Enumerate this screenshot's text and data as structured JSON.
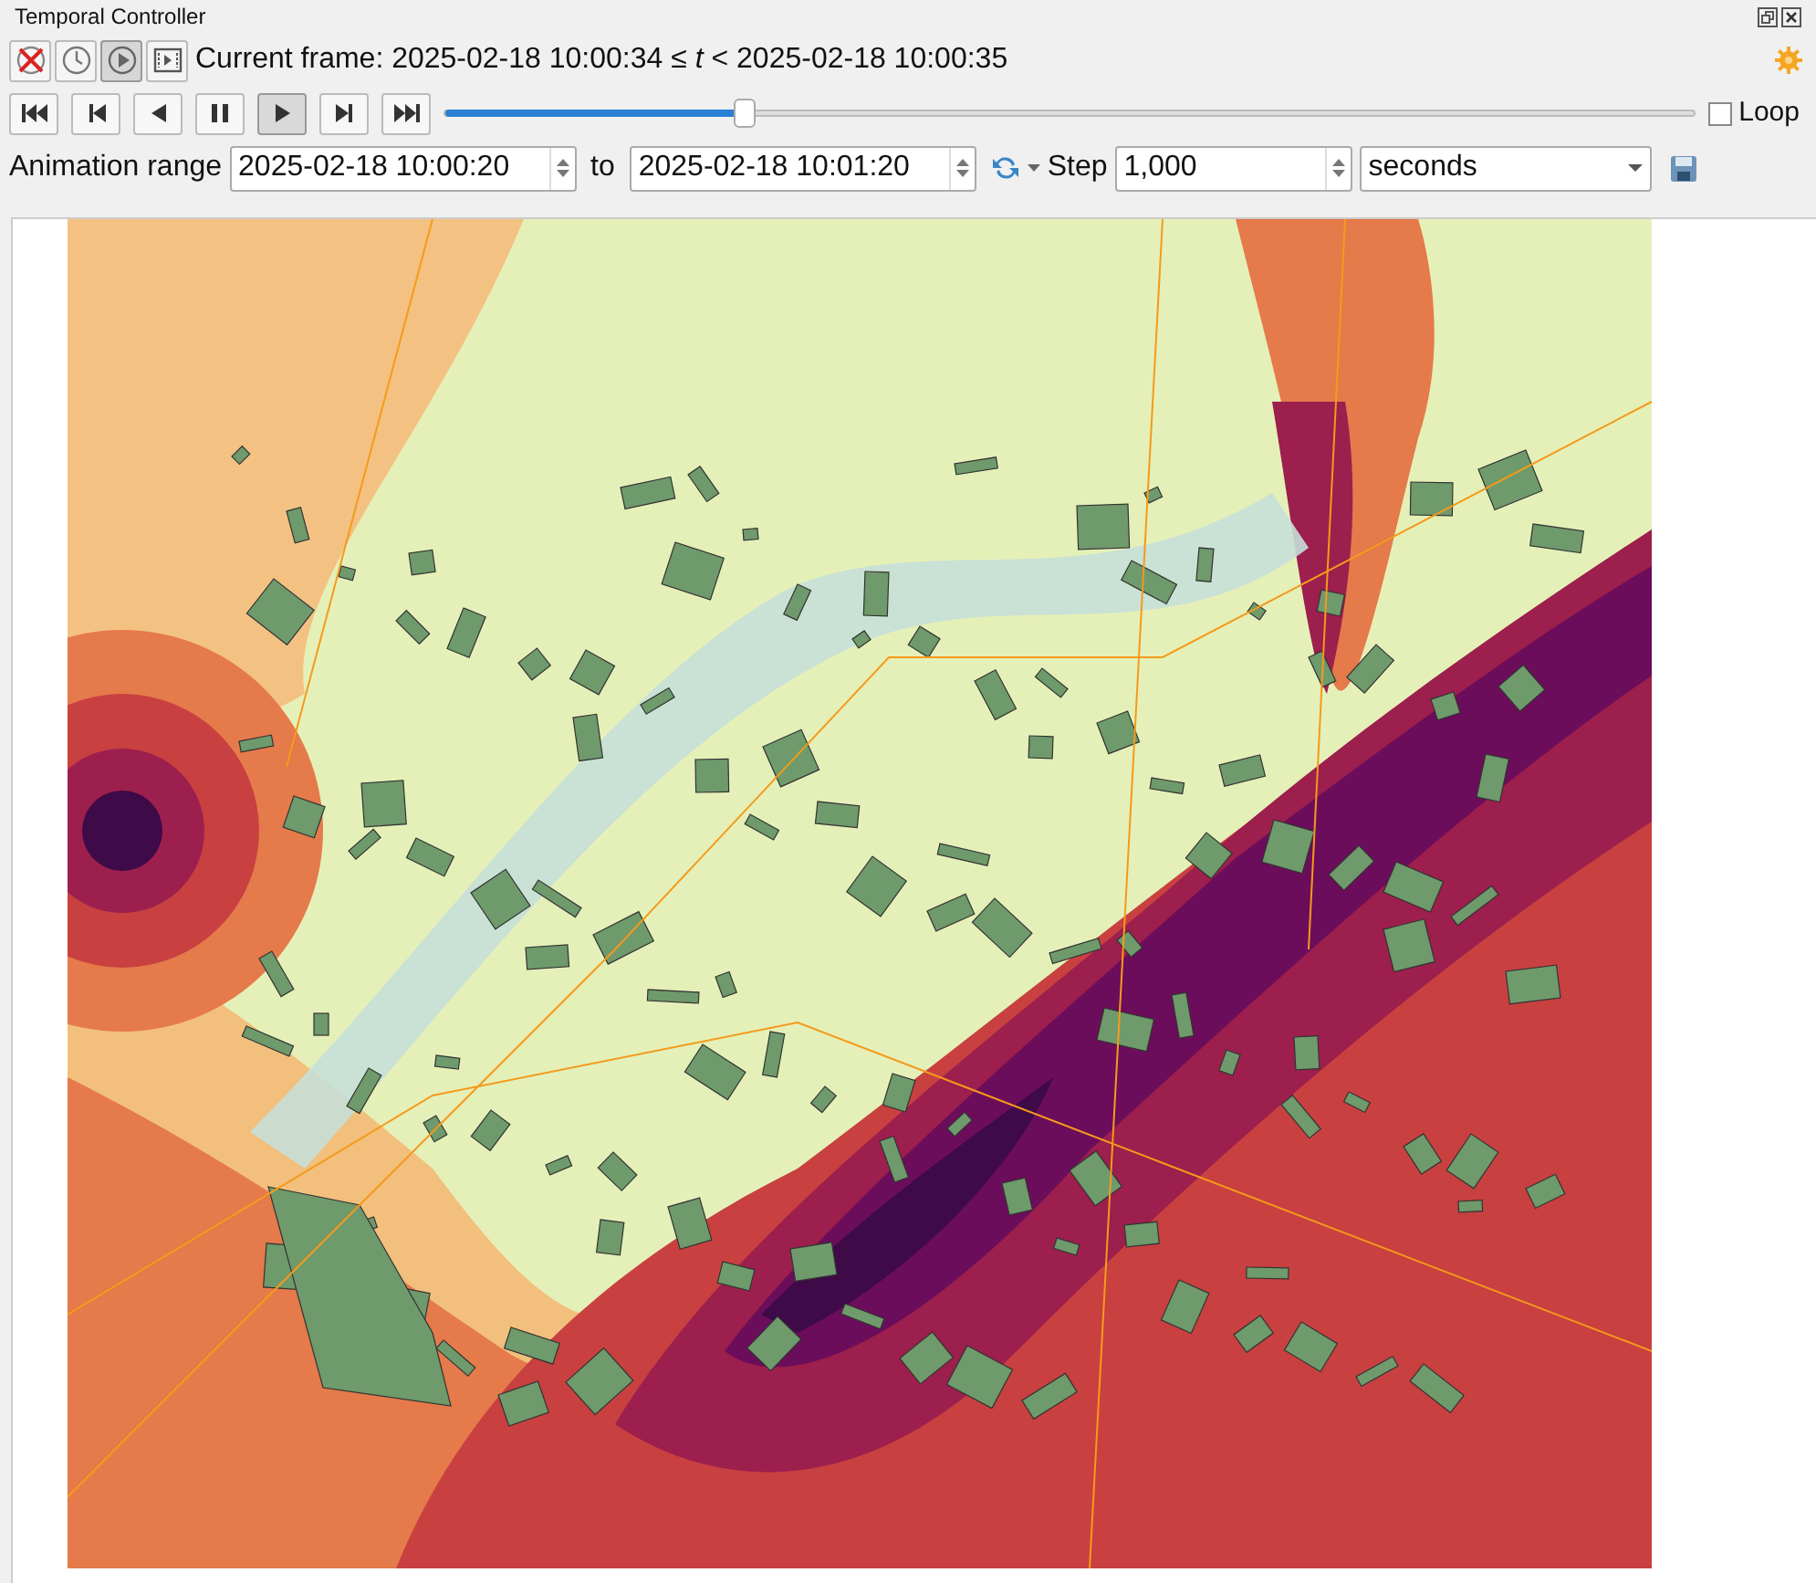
{
  "panel": {
    "title": "Temporal Controller"
  },
  "modes": [
    {
      "kind": "off",
      "selected": false
    },
    {
      "kind": "fixed",
      "selected": false
    },
    {
      "kind": "animated",
      "selected": true
    },
    {
      "kind": "movie",
      "selected": false
    }
  ],
  "current_frame": "Current frame: 2025-02-18 10:00:34 ≤ *t* < 2025-02-18 10:00:35",
  "playback": [
    {
      "kind": "rewind",
      "selected": false
    },
    {
      "kind": "prev",
      "selected": false
    },
    {
      "kind": "reverse",
      "selected": false
    },
    {
      "kind": "pause",
      "selected": false
    },
    {
      "kind": "play",
      "selected": true
    },
    {
      "kind": "next",
      "selected": false
    },
    {
      "kind": "end",
      "selected": false
    }
  ],
  "timeline": {
    "level": 0.24
  },
  "loop": {
    "label": "Loop",
    "checked": false
  },
  "range": {
    "label": "Animation range",
    "start": "2025-02-18 10:00:20",
    "to_label": "to",
    "end": "2025-02-18 10:01:20"
  },
  "step": {
    "label": "Step",
    "value": "1,000",
    "unit": "seconds"
  }
}
